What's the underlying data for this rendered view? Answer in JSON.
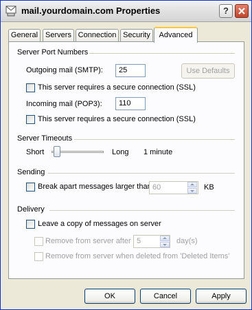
{
  "window": {
    "title": "mail.yourdomain.com Properties",
    "help_glyph": "?",
    "close_glyph": "✕"
  },
  "tabs": [
    {
      "label": "General",
      "active": false
    },
    {
      "label": "Servers",
      "active": false
    },
    {
      "label": "Connection",
      "active": false
    },
    {
      "label": "Security",
      "active": false
    },
    {
      "label": "Advanced",
      "active": true
    }
  ],
  "server_ports": {
    "heading": "Server Port Numbers",
    "outgoing_label": "Outgoing mail (SMTP):",
    "outgoing_value": "25",
    "use_defaults_label": "Use Defaults",
    "smtp_ssl_label": "This server requires a secure connection (SSL)",
    "smtp_ssl_checked": false,
    "incoming_label": "Incoming mail (POP3):",
    "incoming_value": "110",
    "pop3_ssl_label": "This server requires a secure connection (SSL)",
    "pop3_ssl_checked": false
  },
  "timeouts": {
    "heading": "Server Timeouts",
    "short_label": "Short",
    "long_label": "Long",
    "value_text": "1 minute",
    "slider_level": 0.05
  },
  "sending": {
    "heading": "Sending",
    "break_apart_label": "Break apart messages larger than",
    "break_apart_checked": false,
    "size_value": "60",
    "size_unit": "KB"
  },
  "delivery": {
    "heading": "Delivery",
    "leave_copy_label": "Leave a copy of messages on server",
    "leave_copy_checked": false,
    "remove_after_label": "Remove from server after",
    "remove_after_value": "5",
    "remove_after_unit": "day(s)",
    "remove_deleted_label": "Remove from server when deleted from 'Deleted Items'"
  },
  "footer": {
    "ok_label": "OK",
    "cancel_label": "Cancel",
    "apply_label": "Apply"
  },
  "icons": {
    "title": "mail-server-icon"
  }
}
